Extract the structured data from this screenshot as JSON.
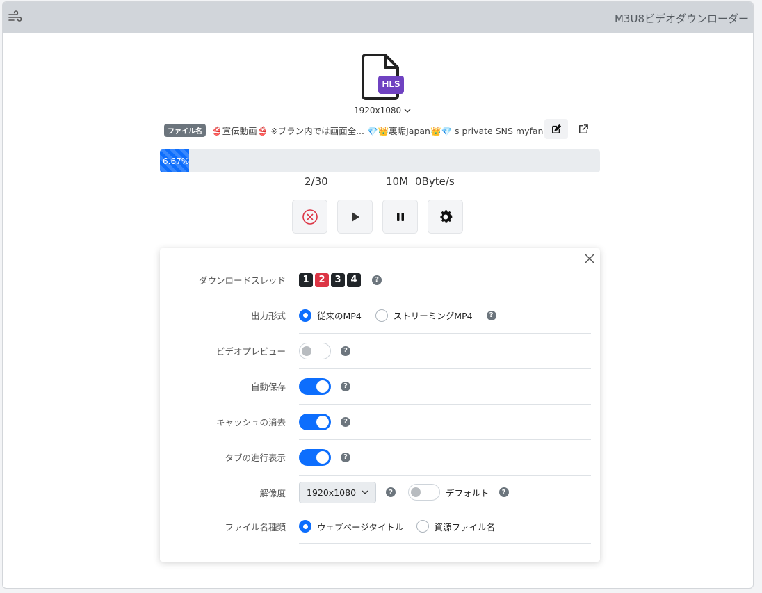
{
  "header": {
    "title": "M3U8ビデオダウンローダー",
    "menu_icon": "wind-icon"
  },
  "file": {
    "icon": "hls-file-icon",
    "format_badge": "HLS",
    "resolution": "1920x1080",
    "name_badge": "ファイル名",
    "name": "👙宣伝動画👙 ※プラン内では画面全... 💎👑裏垢Japan👑💎 s private SNS myfans"
  },
  "progress": {
    "percent": 6.67,
    "label": "6.67%",
    "segments": "2/30",
    "size": "10M",
    "speed": "0Byte/s"
  },
  "controls": {
    "cancel": "cancel-icon",
    "play": "play-icon",
    "pause": "pause-icon",
    "settings": "gear-icon"
  },
  "settings": {
    "threads": {
      "label": "ダウンロードスレッド",
      "options": [
        "1",
        "2",
        "3",
        "4"
      ],
      "selected": "2"
    },
    "output_format": {
      "label": "出力形式",
      "options": [
        "従来のMP4",
        "ストリーミングMP4"
      ],
      "selected": "従来のMP4"
    },
    "video_preview": {
      "label": "ビデオプレビュー",
      "enabled": false
    },
    "auto_save": {
      "label": "自動保存",
      "enabled": true
    },
    "clear_cache": {
      "label": "キャッシュの消去",
      "enabled": true
    },
    "tab_progress": {
      "label": "タブの進行表示",
      "enabled": true
    },
    "resolution": {
      "label": "解像度",
      "value": "1920x1080",
      "default_label": "デフォルト",
      "default_enabled": false
    },
    "filename_type": {
      "label": "ファイル名種類",
      "options": [
        "ウェブページタイトル",
        "資源ファイル名"
      ],
      "selected": "ウェブページタイトル"
    }
  },
  "colors": {
    "accent": "#0d6efd",
    "danger": "#dc3545",
    "hls_purple": "#6f42c1"
  }
}
